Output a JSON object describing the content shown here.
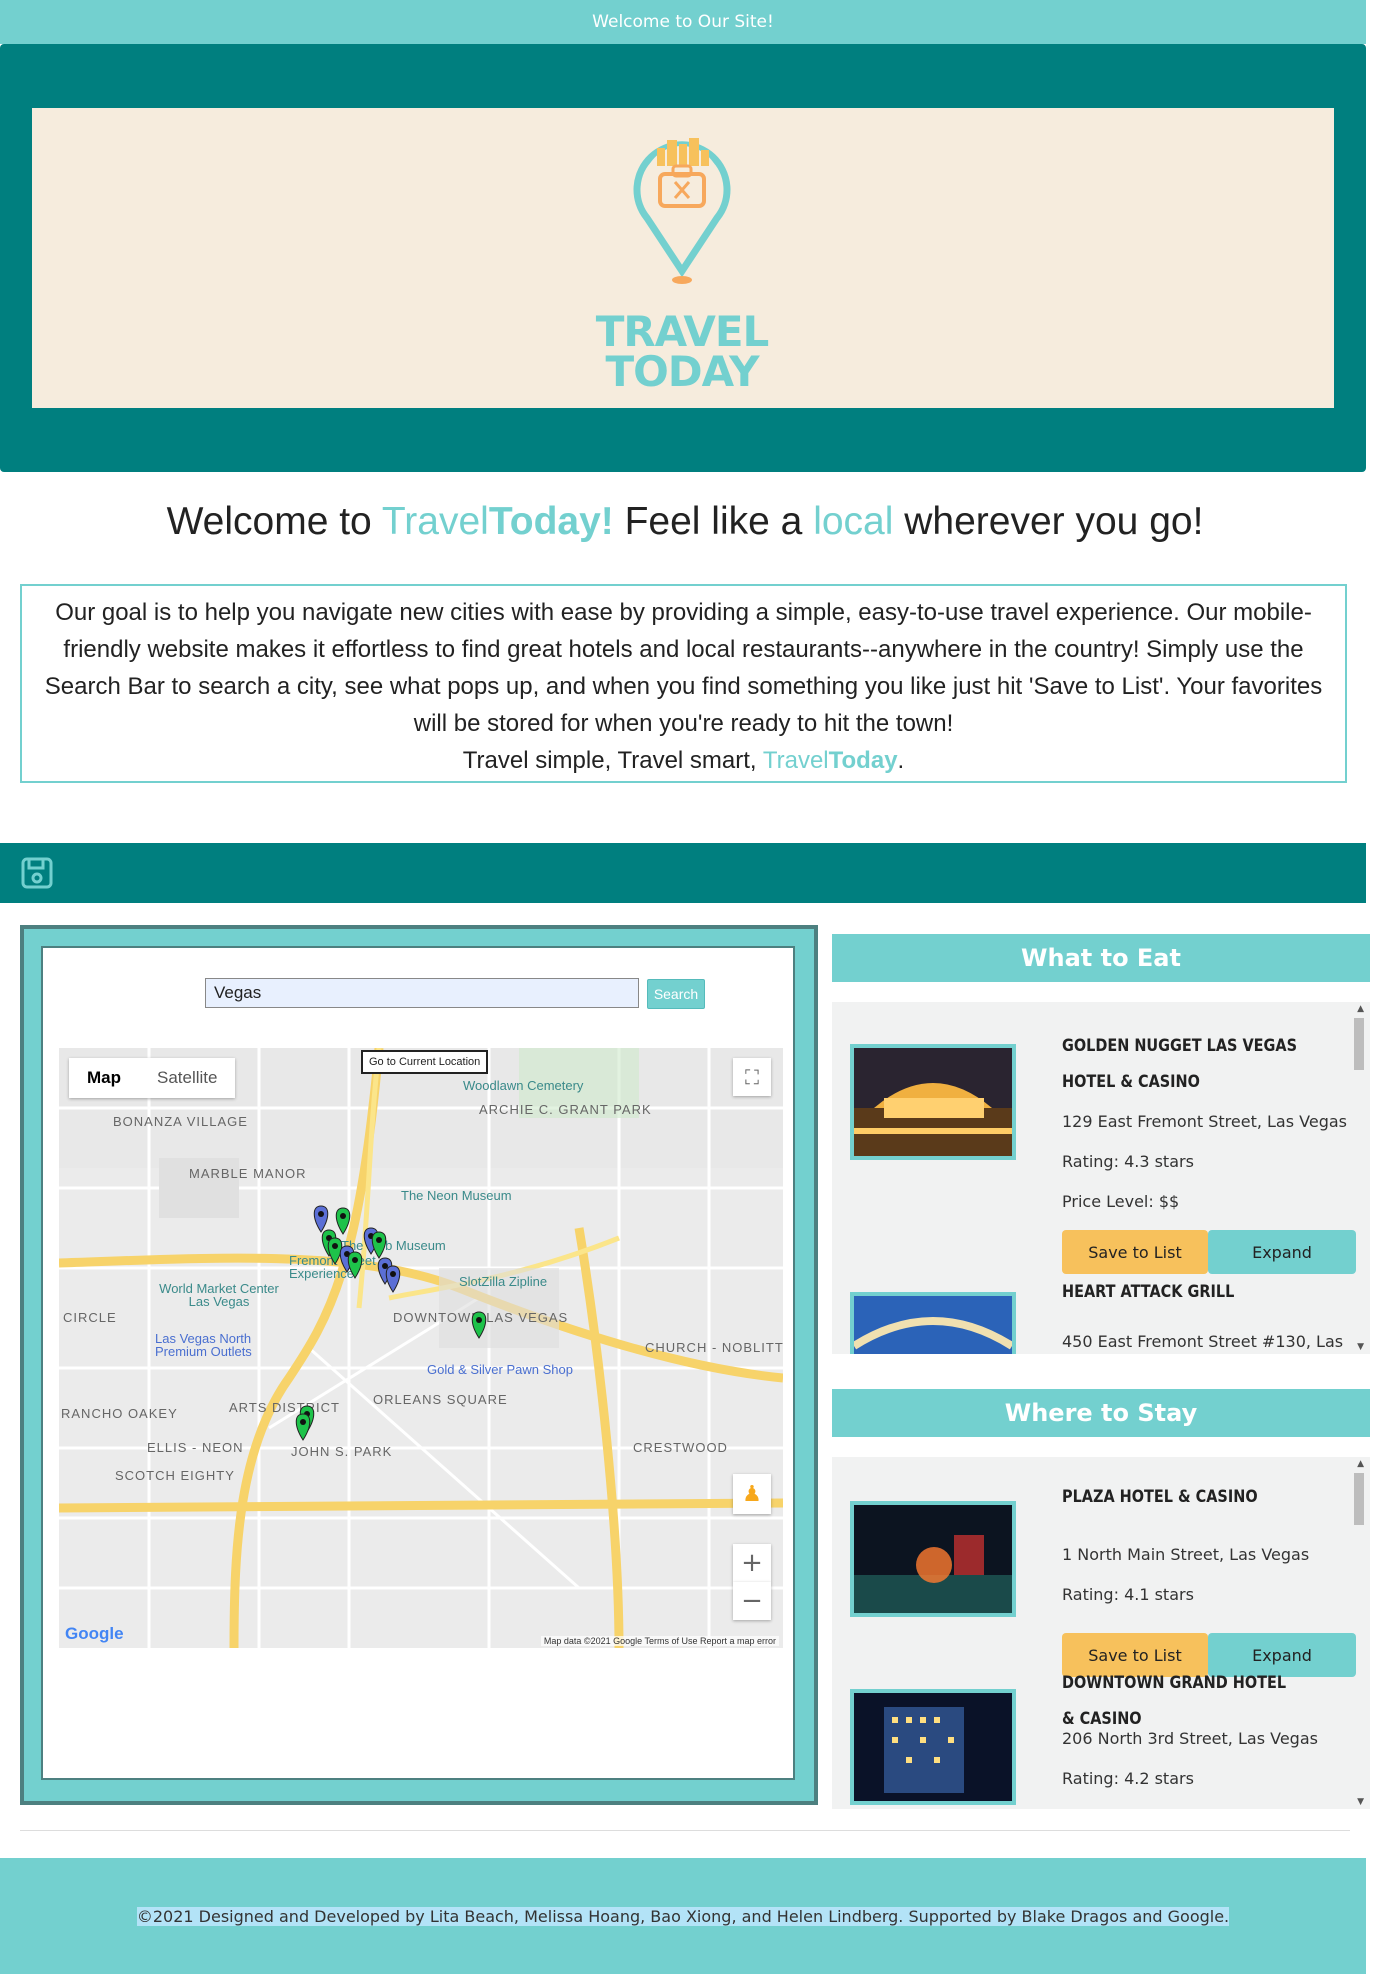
{
  "topbar": {
    "text": "Welcome to Our Site!"
  },
  "logo": {
    "line1": "TRAVEL",
    "line2": "TODAY"
  },
  "welcome": {
    "pre": "Welcome to ",
    "brand_light": "Travel",
    "brand_bold": "Today!",
    "mid": " Feel like a ",
    "local": "local",
    "post": " wherever you go!"
  },
  "intro": {
    "paragraph": "Our goal is to help you navigate new cities with ease by providing a simple, easy-to-use travel experience. Our mobile-friendly website makes it effortless to find great hotels and local restaurants--anywhere in the country! Simply use the Search Bar to search a city, see what pops up, and when you find something you like just hit 'Save to List'. Your favorites will be stored for when you're ready to hit the town!",
    "tagline_pre": "Travel simple, Travel smart, ",
    "brand_light": "Travel",
    "brand_bold": "Today",
    "tagline_end": "."
  },
  "search": {
    "value": "Vegas",
    "button": "Search"
  },
  "map": {
    "type_map": "Map",
    "type_satellite": "Satellite",
    "current_location": "Go to Current Location",
    "zoom_in": "+",
    "zoom_out": "−",
    "labels": [
      "BONANZA VILLAGE",
      "MARBLE MANOR",
      "ARCHIE C. GRANT PARK",
      "DOWNTOWN LAS VEGAS",
      "ARTS DISTRICT",
      "ORLEANS SQUARE",
      "JOHN S. PARK",
      "SCOTCH EIGHTY",
      "ELLIS - NEON",
      "CHURCH - NOBLITT",
      "CRESTWOOD",
      "RANCHO OAKEY",
      "CIRCLE"
    ],
    "pois": [
      "Woodlawn Cemetery",
      "The Neon Museum",
      "The Mob Museum",
      "Fremont Street Experience",
      "SlotZilla Zipline",
      "World Market Center Las Vegas",
      "Las Vegas North Premium Outlets",
      "Gold & Silver Pawn Shop"
    ],
    "footer": "Map data ©2021 Google   Terms of Use   Report a map error",
    "google": "Google"
  },
  "eat": {
    "heading": "What to Eat",
    "items": [
      {
        "name": "Golden Nugget Las Vegas Hotel & Casino",
        "address": "129 East Fremont Street, Las Vegas",
        "rating": "Rating: 4.3 stars",
        "price": "Price Level: $$"
      },
      {
        "name": "Heart Attack Grill",
        "address": "450 East Fremont Street #130, Las"
      }
    ]
  },
  "stay": {
    "heading": "Where to Stay",
    "items": [
      {
        "name": "Plaza Hotel & Casino",
        "address": "1 North Main Street, Las Vegas",
        "rating": "Rating: 4.1 stars"
      },
      {
        "name": "Downtown Grand Hotel & Casino",
        "address": "206 North 3rd Street, Las Vegas",
        "rating": "Rating: 4.2 stars"
      }
    ]
  },
  "buttons": {
    "save": "Save to List",
    "expand": "Expand"
  },
  "footer": {
    "text": "©2021 Designed and Developed by Lita Beach, Melissa Hoang, Bao Xiong, and Helen Lindberg. Supported by Blake Dragos and Google."
  },
  "colors": {
    "teal_dark": "#007f7f",
    "teal_light": "#73d0cf",
    "cream": "#f6ecdd",
    "save_orange": "#f7c15c",
    "pin_green": "#1ec24a",
    "pin_blue": "#5b6fd6"
  }
}
